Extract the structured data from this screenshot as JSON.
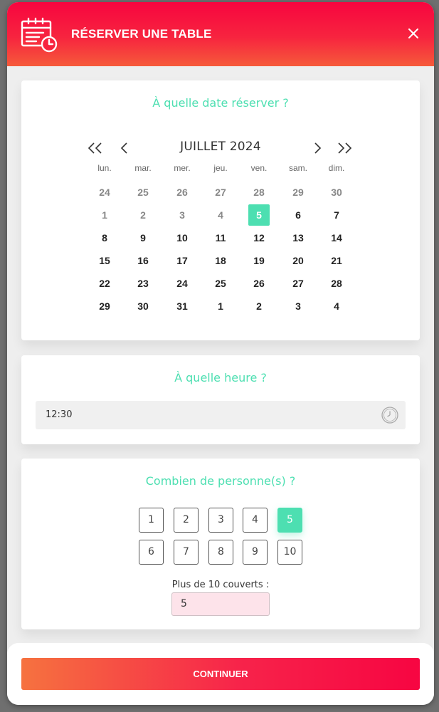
{
  "header": {
    "title": "RÉSERVER UNE TABLE",
    "icon": "calendar-clock-icon",
    "close_icon": "close-icon"
  },
  "date_section": {
    "title": "À quelle date réserver ?",
    "month": "JUILLET",
    "year": "2024",
    "weekdays": [
      "lun.",
      "mar.",
      "mer.",
      "jeu.",
      "ven.",
      "sam.",
      "dim."
    ],
    "weeks": [
      [
        "24",
        "25",
        "26",
        "27",
        "28",
        "29",
        "30"
      ],
      [
        "1",
        "2",
        "3",
        "4",
        "5",
        "6",
        "7"
      ],
      [
        "8",
        "9",
        "10",
        "11",
        "12",
        "13",
        "14"
      ],
      [
        "15",
        "16",
        "17",
        "18",
        "19",
        "20",
        "21"
      ],
      [
        "22",
        "23",
        "24",
        "25",
        "26",
        "27",
        "28"
      ],
      [
        "29",
        "30",
        "31",
        "1",
        "2",
        "3",
        "4"
      ]
    ],
    "selected_day": "5",
    "muted_cells": [
      "0-0",
      "0-1",
      "0-2",
      "0-3",
      "0-4",
      "0-5",
      "0-6",
      "1-0",
      "1-1",
      "1-2",
      "1-3"
    ]
  },
  "time_section": {
    "title": "À quelle heure ?",
    "value": "12:30",
    "icon": "clock-icon"
  },
  "people_section": {
    "title": "Combien de personne(s) ?",
    "options": [
      "1",
      "2",
      "3",
      "4",
      "5",
      "6",
      "7",
      "8",
      "9",
      "10"
    ],
    "selected": "5",
    "more_label": "Plus de 10 couverts :",
    "more_value": "5"
  },
  "footer": {
    "continue_label": "CONTINUER"
  },
  "colors": {
    "accent": "#4ddfb1",
    "brand": "#f7053f",
    "brand_orange": "#f6723f",
    "input_pink": "#fde3ea"
  }
}
